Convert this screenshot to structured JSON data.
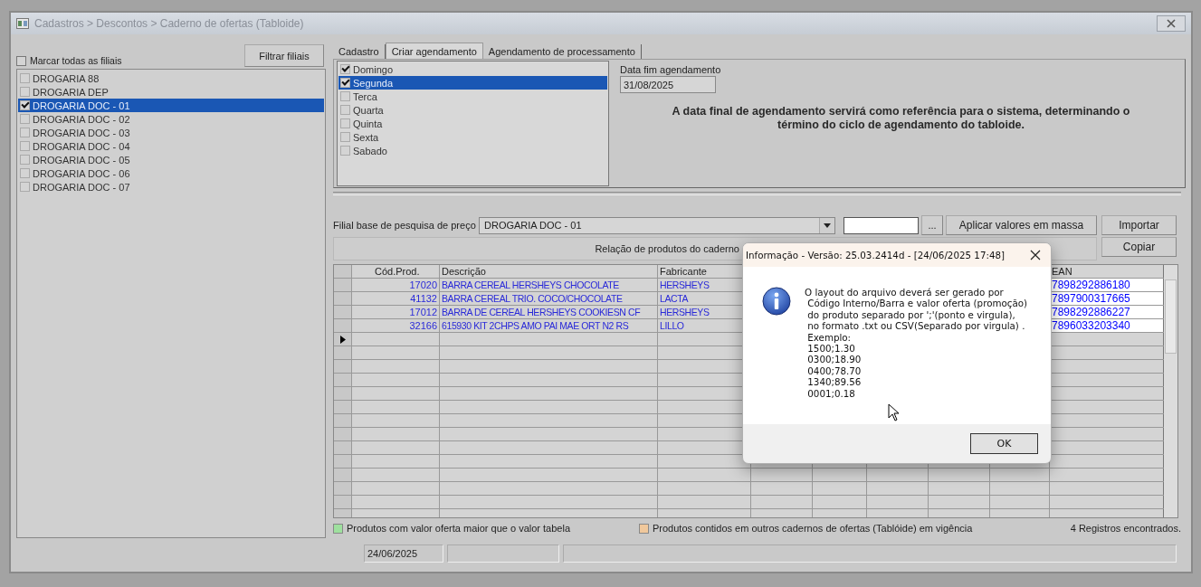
{
  "window": {
    "title": "Cadastros > Descontos > Caderno de ofertas (Tabloide)"
  },
  "branches": {
    "filter_button": "Filtrar filiais",
    "select_all": {
      "label": "Marcar todas as filiais",
      "checked": false
    },
    "items": [
      {
        "label": "DROGARIA 88",
        "checked": false,
        "selected": false
      },
      {
        "label": "DROGARIA DEP",
        "checked": false,
        "selected": false
      },
      {
        "label": "DROGARIA DOC - 01",
        "checked": true,
        "selected": true
      },
      {
        "label": "DROGARIA DOC - 02",
        "checked": false,
        "selected": false
      },
      {
        "label": "DROGARIA DOC - 03",
        "checked": false,
        "selected": false
      },
      {
        "label": "DROGARIA DOC - 04",
        "checked": false,
        "selected": false
      },
      {
        "label": "DROGARIA DOC - 05",
        "checked": false,
        "selected": false
      },
      {
        "label": "DROGARIA DOC - 06",
        "checked": false,
        "selected": false
      },
      {
        "label": "DROGARIA DOC - 07",
        "checked": false,
        "selected": false
      }
    ]
  },
  "tabs": [
    {
      "label": "Cadastro",
      "selected": false
    },
    {
      "label": "Criar agendamento",
      "selected": true
    },
    {
      "label": "Agendamento de processamento",
      "selected": false
    }
  ],
  "weekdays": [
    {
      "label": "Domingo",
      "checked": true,
      "selected": false
    },
    {
      "label": "Segunda",
      "checked": true,
      "selected": true
    },
    {
      "label": "Terca",
      "checked": false,
      "selected": false
    },
    {
      "label": "Quarta",
      "checked": false,
      "selected": false
    },
    {
      "label": "Quinta",
      "checked": false,
      "selected": false
    },
    {
      "label": "Sexta",
      "checked": false,
      "selected": false
    },
    {
      "label": "Sabado",
      "checked": false,
      "selected": false
    }
  ],
  "end_date": {
    "label": "Data fim agendamento",
    "value": "31/08/2025"
  },
  "notice": "A data final de agendamento servirá como referência para o sistema, determinando o término do ciclo de agendamento do tabloide.",
  "toolbar": {
    "branch_label": "Filial base de pesquisa de preço",
    "branch_value": "DROGARIA DOC - 01",
    "browse_button": "...",
    "apply_button": "Aplicar valores em massa",
    "import_button": "Importar",
    "copy_button": "Copiar"
  },
  "table": {
    "title": "Relação de produtos do caderno",
    "columns": [
      "Cód.Prod.",
      "Descrição",
      "Fabricante",
      "EAN"
    ],
    "rows": [
      {
        "code": "17020",
        "description": "BARRA CEREAL HERSHEYS CHOCOLATE",
        "manufacturer": "HERSHEYS",
        "ean": "7898292886180"
      },
      {
        "code": "41132",
        "description": "BARRA CEREAL TRIO. COCO/CHOCOLATE",
        "manufacturer": "LACTA",
        "ean": "7897900317665"
      },
      {
        "code": "17012",
        "description": "BARRA DE CEREAL HERSHEYS COOKIESN CF",
        "manufacturer": "HERSHEYS",
        "ean": "7898292886227"
      },
      {
        "code": "32166",
        "description": "615930 KIT 2CHPS AMO PAI  MAE ORT N2 RS",
        "manufacturer": "LILLO",
        "ean": "7896033203340"
      }
    ],
    "new_row": {
      "current": true
    }
  },
  "legend": [
    {
      "label": "Produtos com valor oferta maior que o valor tabela",
      "color": "#9ee09e"
    },
    {
      "label": "Produtos contidos em outros cadernos de ofertas (Tablóide) em vigência",
      "color": "#f0c89c"
    }
  ],
  "record_count": "4 Registros encontrados.",
  "status_bar": {
    "date": "24/06/2025"
  },
  "dialog": {
    "title": "Informação - Versão: 25.03.2414d - [24/06/2025 17:48]",
    "message": "O layout do arquivo deverá ser gerado por\n Código Interno/Barra e valor oferta (promoção)\n do produto separado por ';'(ponto e virgula),\n no formato .txt ou CSV(Separado por virgula) .\n Exemplo:\n 1500;1.30\n 0300;18.90\n 0400;78.70\n 1340;89.56\n 0001;0.18",
    "ok_button": "OK"
  }
}
